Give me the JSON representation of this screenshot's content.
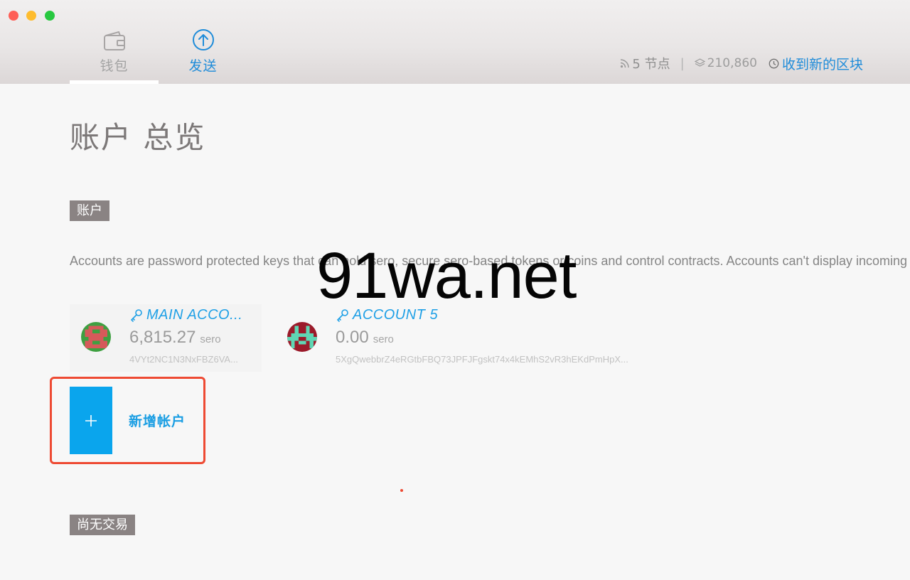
{
  "nav": {
    "wallet_label": "钱包",
    "send_label": "发送"
  },
  "status": {
    "peers": "5 节点",
    "separator": "|",
    "block_number": "210,860",
    "new_block": "收到新的区块"
  },
  "page": {
    "title": "账户 总览",
    "accounts_section": "账户",
    "description": "Accounts are password protected keys that can hold sero, secure sero-based tokens or coins and control contracts. Accounts can't display incoming transactions.",
    "no_transactions": "尚无交易"
  },
  "accounts": [
    {
      "name": "MAIN ACCO...",
      "balance": "6,815.27",
      "unit": "sero",
      "address": "4VYt2NC1N3NxFBZ6VA..."
    },
    {
      "name": "ACCOUNT 5",
      "balance": "0.00",
      "unit": "sero",
      "address": "5XgQwebbrZ4eRGtbFBQ73JPFJFgskt74x4kEMhS2vR3hEKdPmHpX..."
    }
  ],
  "add_account": {
    "label": "新增帐户",
    "plus": "+"
  },
  "watermark": "91wa.net",
  "colors": {
    "accent": "#1f8cd9",
    "add_button": "#0aa5ed",
    "highlight": "#ee4a33",
    "section_tag": "#8a8383"
  }
}
